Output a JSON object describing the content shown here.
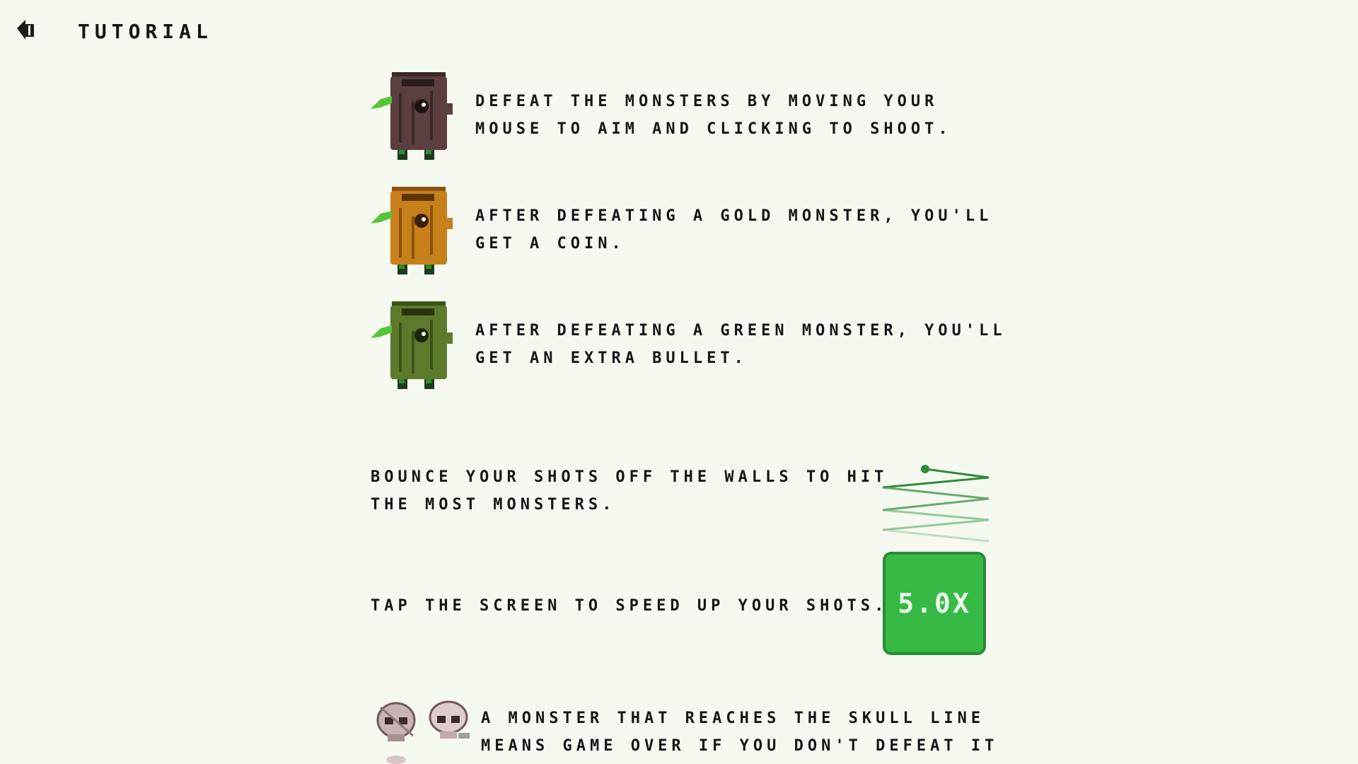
{
  "header": {
    "title": "TUTORIAL"
  },
  "monsters": [
    {
      "text_line1": "DEFEAT THE MONSTERS BY MOVING YOUR",
      "text_line2": "MOUSE TO AIM AND CLICKING TO SHOOT.",
      "body_color": "#5b3f3f",
      "body_dark": "#3c2828"
    },
    {
      "text_line1": "AFTER DEFEATING A GOLD MONSTER, YOU'LL",
      "text_line2": "GET A COIN.",
      "body_color": "#c8801b",
      "body_dark": "#8a520e"
    },
    {
      "text_line1": "AFTER DEFEATING A GREEN MONSTER, YOU'LL",
      "text_line2": "GET AN EXTRA BULLET.",
      "body_color": "#5d7a2b",
      "body_dark": "#3b5218"
    }
  ],
  "bounce": {
    "line1": "BOUNCE YOUR SHOTS OFF THE WALLS TO HIT",
    "line2": "THE MOST MONSTERS."
  },
  "speed": {
    "text": "TAP THE SCREEN TO SPEED UP YOUR SHOTS.",
    "value": "5.0X"
  },
  "skull": {
    "line1": "A MONSTER THAT REACHES THE SKULL LINE",
    "line2": "MEANS GAME OVER IF YOU DON'T DEFEAT IT"
  },
  "colors": {
    "background": "#f6f9f0",
    "accent_green": "#37b946",
    "leaf": "#56c43a"
  }
}
